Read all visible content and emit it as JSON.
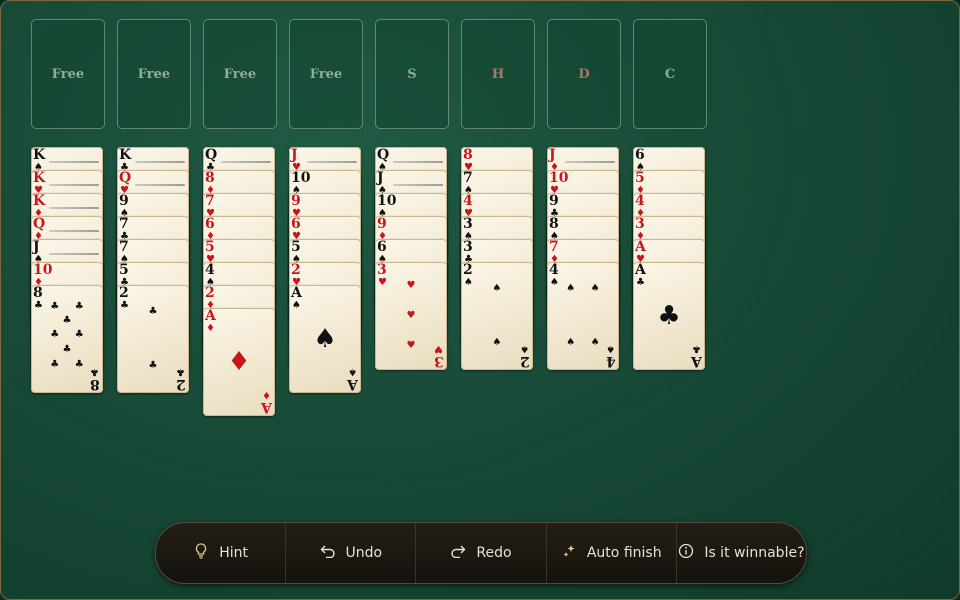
{
  "slots": [
    {
      "label": "Free",
      "red": false
    },
    {
      "label": "Free",
      "red": false
    },
    {
      "label": "Free",
      "red": false
    },
    {
      "label": "Free",
      "red": false
    },
    {
      "label": "S",
      "red": false
    },
    {
      "label": "H",
      "red": true
    },
    {
      "label": "D",
      "red": true
    },
    {
      "label": "C",
      "red": false
    }
  ],
  "columns": [
    [
      {
        "r": "K",
        "s": "spade"
      },
      {
        "r": "K",
        "s": "heart"
      },
      {
        "r": "K",
        "s": "diamond"
      },
      {
        "r": "Q",
        "s": "diamond"
      },
      {
        "r": "J",
        "s": "spade"
      },
      {
        "r": "10",
        "s": "diamond"
      },
      {
        "r": "8",
        "s": "club"
      }
    ],
    [
      {
        "r": "K",
        "s": "club"
      },
      {
        "r": "Q",
        "s": "heart"
      },
      {
        "r": "9",
        "s": "spade"
      },
      {
        "r": "7",
        "s": "club"
      },
      {
        "r": "7",
        "s": "spade"
      },
      {
        "r": "5",
        "s": "club"
      },
      {
        "r": "2",
        "s": "club"
      }
    ],
    [
      {
        "r": "Q",
        "s": "club"
      },
      {
        "r": "8",
        "s": "diamond"
      },
      {
        "r": "7",
        "s": "heart"
      },
      {
        "r": "6",
        "s": "diamond"
      },
      {
        "r": "5",
        "s": "heart"
      },
      {
        "r": "4",
        "s": "spade"
      },
      {
        "r": "2",
        "s": "diamond"
      },
      {
        "r": "A",
        "s": "diamond"
      }
    ],
    [
      {
        "r": "J",
        "s": "heart"
      },
      {
        "r": "10",
        "s": "spade"
      },
      {
        "r": "9",
        "s": "heart"
      },
      {
        "r": "6",
        "s": "heart"
      },
      {
        "r": "5",
        "s": "spade"
      },
      {
        "r": "2",
        "s": "heart"
      },
      {
        "r": "A",
        "s": "spade"
      }
    ],
    [
      {
        "r": "Q",
        "s": "spade"
      },
      {
        "r": "J",
        "s": "spade"
      },
      {
        "r": "10",
        "s": "spade"
      },
      {
        "r": "9",
        "s": "diamond"
      },
      {
        "r": "6",
        "s": "spade"
      },
      {
        "r": "3",
        "s": "heart"
      }
    ],
    [
      {
        "r": "8",
        "s": "heart"
      },
      {
        "r": "7",
        "s": "spade"
      },
      {
        "r": "4",
        "s": "heart"
      },
      {
        "r": "3",
        "s": "spade"
      },
      {
        "r": "3",
        "s": "club"
      },
      {
        "r": "2",
        "s": "spade"
      }
    ],
    [
      {
        "r": "J",
        "s": "diamond"
      },
      {
        "r": "10",
        "s": "heart"
      },
      {
        "r": "9",
        "s": "club"
      },
      {
        "r": "8",
        "s": "spade"
      },
      {
        "r": "7",
        "s": "diamond"
      },
      {
        "r": "4",
        "s": "spade"
      }
    ],
    [
      {
        "r": "6",
        "s": "spade"
      },
      {
        "r": "5",
        "s": "diamond"
      },
      {
        "r": "4",
        "s": "diamond"
      },
      {
        "r": "3",
        "s": "diamond"
      },
      {
        "r": "A",
        "s": "heart"
      },
      {
        "r": "A",
        "s": "club"
      }
    ]
  ],
  "toolbar": {
    "hint": {
      "label": "Hint",
      "icon": "lightbulb-icon"
    },
    "undo": {
      "label": "Undo",
      "icon": "undo-icon"
    },
    "redo": {
      "label": "Redo",
      "icon": "redo-icon"
    },
    "auto_finish": {
      "label": "Auto finish",
      "icon": "sparkle-icon"
    },
    "winnable": {
      "label": "Is it winnable?",
      "icon": "info-icon"
    }
  },
  "colors": {
    "felt": "#174a36",
    "card": "#f6efdc",
    "red_suit": "#c8161d",
    "toolbar": "#1b1712",
    "accent": "#e6c98a"
  }
}
